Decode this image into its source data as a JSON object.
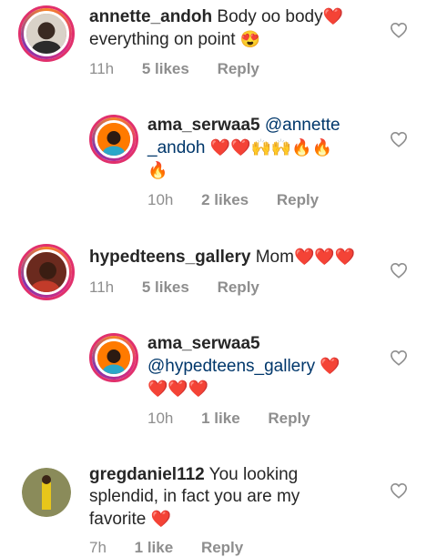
{
  "comments": [
    {
      "username": "annette_andoh",
      "text": "Body oo body",
      "text_emoji": "❤️",
      "text_line2": "everything on point",
      "text_emoji2": "😍",
      "time": "11h",
      "likes": "5 likes",
      "reply": "Reply",
      "avatar_icon": "profile-photo"
    },
    {
      "username": "ama_serwaa5",
      "mention_part1": "@annette",
      "mention_part2": "_andoh",
      "emoji_line1": "❤️❤️🙌🙌🔥🔥",
      "emoji_line2": "🔥",
      "time": "10h",
      "likes": "2 likes",
      "reply": "Reply",
      "avatar_icon": "profile-photo"
    },
    {
      "username": "hypedteens_gallery",
      "text": "Mom",
      "text_emoji": "❤️❤️❤️",
      "time": "11h",
      "likes": "5 likes",
      "reply": "Reply",
      "avatar_icon": "profile-photo"
    },
    {
      "username": "ama_serwaa5",
      "mention": "@hypedteens_gallery",
      "emoji_line1": "❤️",
      "emoji_line2": "❤️❤️❤️",
      "time": "10h",
      "likes": "1 like",
      "reply": "Reply",
      "avatar_icon": "profile-photo"
    },
    {
      "username": "gregdaniel112",
      "text": "You looking",
      "text_line2": "splendid, in fact you are my",
      "text_line3": "favorite",
      "text_emoji": "❤️",
      "time": "7h",
      "likes": "1 like",
      "reply": "Reply",
      "avatar_icon": "profile-photo"
    }
  ],
  "colors": {
    "text": "#262626",
    "meta": "#8e8e8e",
    "mention": "#00376b",
    "heart": "#ed1c24"
  },
  "icons": {
    "like": "heart-outline-icon"
  }
}
